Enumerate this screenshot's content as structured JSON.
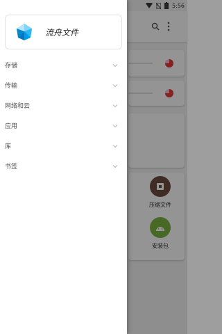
{
  "status_bar": {
    "time": "5:56"
  },
  "app": {
    "title": "流舟文件"
  },
  "menu": {
    "items": [
      {
        "label": "存储"
      },
      {
        "label": "传输"
      },
      {
        "label": "网络和云"
      },
      {
        "label": "应用"
      },
      {
        "label": "库"
      },
      {
        "label": "书签"
      }
    ]
  },
  "background": {
    "categories": [
      {
        "label": "压缩文件",
        "color": "#6d4c41"
      },
      {
        "label": "安装包",
        "color": "#7cb342"
      }
    ]
  },
  "colors": {
    "accent": "#e53935",
    "scrim": "rgba(0,0,0,0.42)"
  }
}
